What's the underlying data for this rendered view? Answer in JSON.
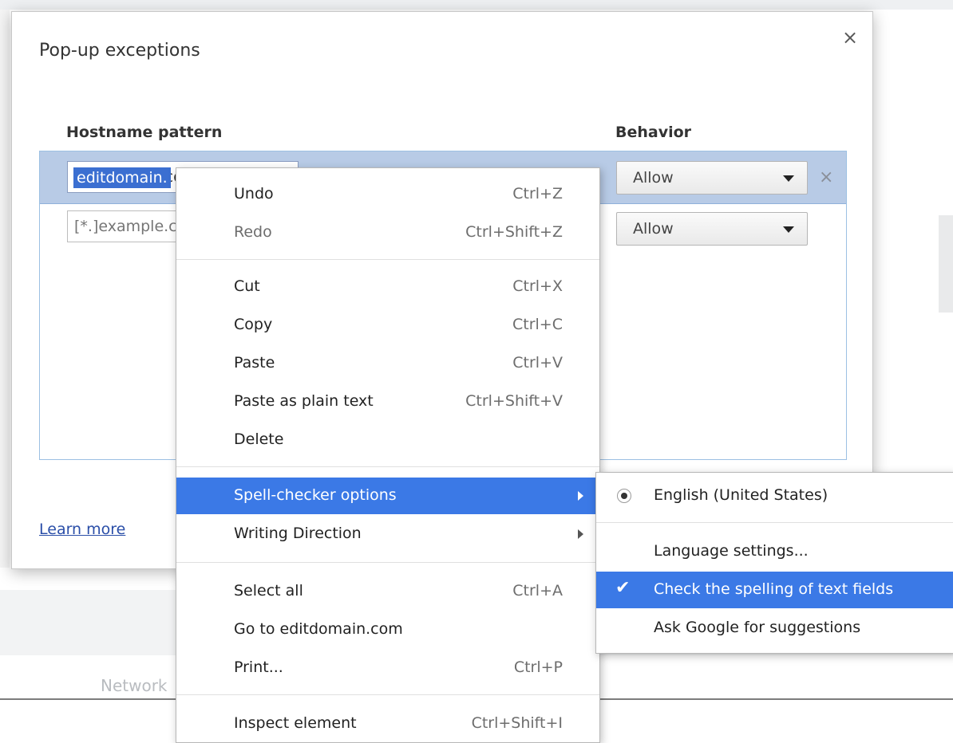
{
  "background": {
    "network_label": "Network"
  },
  "dialog": {
    "title": "Pop-up exceptions",
    "close_glyph": "×",
    "columns": {
      "hostname": "Hostname pattern",
      "behavior": "Behavior"
    },
    "rows": [
      {
        "hostname_value": "editdomain.com",
        "hostname_visible_selected": "editdomain.",
        "behavior": "Allow",
        "remove_glyph": "×"
      },
      {
        "hostname_placeholder": "[*.]example.com",
        "behavior": "Allow"
      }
    ],
    "learn_more": "Learn more"
  },
  "context_menu": {
    "items": [
      {
        "label": "Undo",
        "shortcut": "Ctrl+Z"
      },
      {
        "label": "Redo",
        "shortcut": "Ctrl+Shift+Z",
        "disabled": true
      },
      {
        "label": "Cut",
        "shortcut": "Ctrl+X"
      },
      {
        "label": "Copy",
        "shortcut": "Ctrl+C"
      },
      {
        "label": "Paste",
        "shortcut": "Ctrl+V"
      },
      {
        "label": "Paste as plain text",
        "shortcut": "Ctrl+Shift+V"
      },
      {
        "label": "Delete",
        "shortcut": ""
      },
      {
        "label": "Spell-checker options",
        "submenu": true,
        "highlighted": true
      },
      {
        "label": "Writing Direction",
        "submenu": true
      },
      {
        "label": "Select all",
        "shortcut": "Ctrl+A"
      },
      {
        "label": "Go to editdomain.com",
        "shortcut": ""
      },
      {
        "label": "Print...",
        "shortcut": "Ctrl+P"
      },
      {
        "label": "Inspect element",
        "shortcut": "Ctrl+Shift+I"
      }
    ]
  },
  "spell_submenu": {
    "items": [
      {
        "label": "English (United States)",
        "radio_selected": true
      },
      {
        "label": "Language settings..."
      },
      {
        "label": "Check the spelling of text fields",
        "checked": true,
        "highlighted": true
      },
      {
        "label": "Ask Google for suggestions"
      }
    ],
    "check_glyph": "✔"
  },
  "colors": {
    "selected_row": "#b8cbe6",
    "menu_highlight": "#3b79e6",
    "link": "#2a4ea8"
  }
}
